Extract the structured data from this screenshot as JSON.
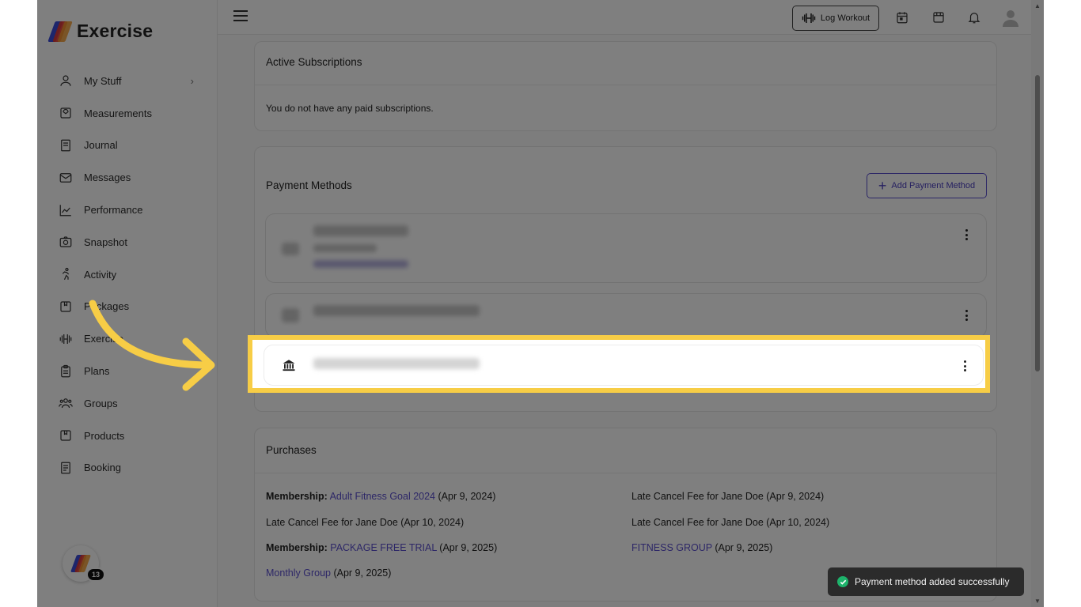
{
  "app": {
    "name": "Exercise",
    "brand_colors": [
      "#3a4ad8",
      "#e8392f",
      "#f29a2e"
    ],
    "accent": "#5b4fcf",
    "highlight_color": "#f7cd46"
  },
  "sidebar": {
    "items": [
      {
        "label": "My Stuff",
        "icon": "user-icon"
      },
      {
        "label": "Measurements",
        "icon": "scale-icon"
      },
      {
        "label": "Journal",
        "icon": "journal-icon"
      },
      {
        "label": "Messages",
        "icon": "mail-icon"
      },
      {
        "label": "Performance",
        "icon": "chart-icon"
      },
      {
        "label": "Snapshot",
        "icon": "camera-icon"
      },
      {
        "label": "Activity",
        "icon": "running-icon"
      },
      {
        "label": "Packages",
        "icon": "package-icon"
      },
      {
        "label": "Exercise",
        "icon": "dumbbell-icon"
      },
      {
        "label": "Plans",
        "icon": "clipboard-icon"
      },
      {
        "label": "Groups",
        "icon": "groups-icon"
      },
      {
        "label": "Products",
        "icon": "box-icon"
      },
      {
        "label": "Booking",
        "icon": "book-icon"
      }
    ],
    "notification_count": "13"
  },
  "topbar": {
    "log_workout_label": "Log Workout",
    "icons": [
      "calendar-icon",
      "store-icon",
      "bell-icon",
      "avatar-icon"
    ]
  },
  "subscriptions": {
    "title": "Active Subscriptions",
    "empty_text": "You do not have any paid subscriptions."
  },
  "payment_methods": {
    "title": "Payment Methods",
    "add_label": "Add Payment Method",
    "new_method_icon": "bank-icon"
  },
  "purchases": {
    "title": "Purchases",
    "rows": [
      {
        "prefix": "Membership:",
        "link": "Adult Fitness Goal 2024",
        "suffix": "(Apr 9, 2024)"
      },
      {
        "prefix": "",
        "link": "",
        "suffix": "Late Cancel Fee for Jane Doe (Apr 9, 2024)"
      },
      {
        "prefix": "",
        "link": "",
        "suffix": "Late Cancel Fee for Jane Doe (Apr 10, 2024)"
      },
      {
        "prefix": "",
        "link": "",
        "suffix": "Late Cancel Fee for Jane Doe (Apr 10, 2024)"
      },
      {
        "prefix": "Membership:",
        "link": "PACKAGE FREE TRIAL",
        "suffix": "(Apr 9, 2025)"
      },
      {
        "prefix": "",
        "link": "FITNESS GROUP",
        "suffix": "(Apr 9, 2025)"
      },
      {
        "prefix": "",
        "link": "Monthly Group",
        "suffix": "(Apr 9, 2025)"
      }
    ]
  },
  "toast": {
    "message": "Payment method added successfully"
  }
}
